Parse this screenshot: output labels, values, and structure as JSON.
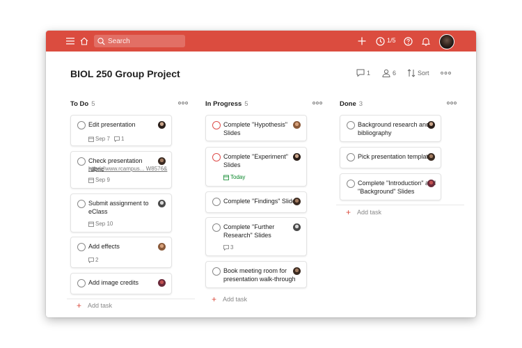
{
  "header": {
    "search_placeholder": "Search",
    "karma": "1/5"
  },
  "project": {
    "title": "BIOL 250 Group Project",
    "comments_count": "1",
    "people_count": "6",
    "sort_label": "Sort"
  },
  "columns": [
    {
      "name": "To Do",
      "count": "5"
    },
    {
      "name": "In Progress",
      "count": "5"
    },
    {
      "name": "Done",
      "count": "3"
    }
  ],
  "todo": {
    "tasks": [
      {
        "title": "Edit presentation",
        "date": "Sep 7",
        "comments": "1"
      },
      {
        "title": "Check presentation rubric",
        "link": "https://www.rcampus... W8576&",
        "date": "Sep 9"
      },
      {
        "title": "Submit assignment to eClass",
        "date": "Sep 10"
      },
      {
        "title": "Add effects",
        "comments": "2"
      },
      {
        "title": "Add image credits"
      }
    ],
    "add_label": "Add task"
  },
  "progress": {
    "tasks": [
      {
        "title": "Complete \"Hypothesis\" Slides"
      },
      {
        "title": "Complete \"Experiment\" Slides",
        "date": "Today"
      },
      {
        "title": "Complete \"Findings\" Slides"
      },
      {
        "title": "Complete \"Further Research\" Slides",
        "comments": "3"
      },
      {
        "title": "Book meeting room for presentation walk-through"
      }
    ],
    "add_label": "Add task"
  },
  "done": {
    "tasks": [
      {
        "title": "Background research and bibliography"
      },
      {
        "title": "Pick presentation template"
      },
      {
        "title": "Complete \"Introduction\" and \"Background\" Slides"
      }
    ],
    "add_label": "Add task"
  },
  "colors": {
    "brand": "#db4c3f",
    "today": "#058527",
    "priority_ring": "#de4c4a"
  }
}
